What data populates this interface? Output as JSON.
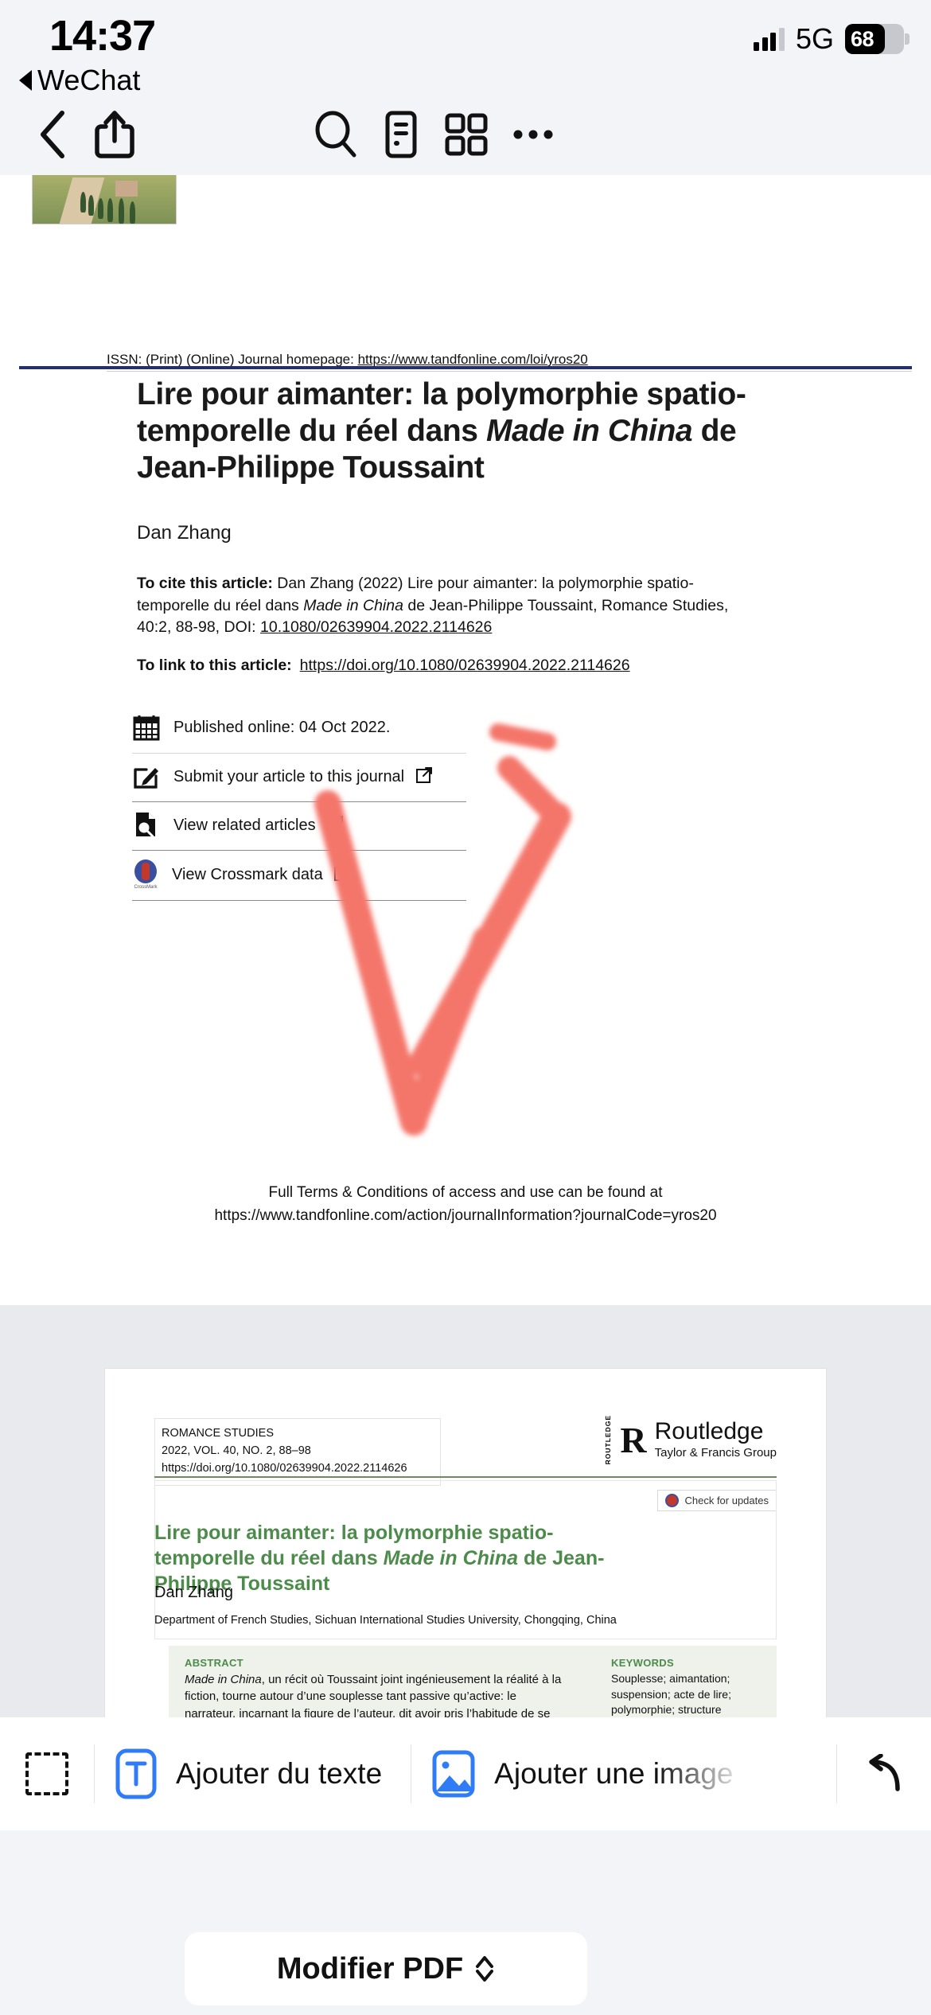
{
  "status_bar": {
    "time": "14:37",
    "back_app": "WeChat",
    "network": "5G",
    "battery": "68"
  },
  "toolbar": {
    "back": "back-chevron",
    "share": "share",
    "search": "search",
    "outline": "outline",
    "thumbnails": "thumbnails",
    "more": "more"
  },
  "document": {
    "page1": {
      "issn_line": "ISSN: (Print) (Online) Journal homepage: ",
      "issn_url": "https://www.tandfonline.com/loi/yros20",
      "title_part1": "Lire pour aimanter: la polymorphie spatio-temporelle du réel dans ",
      "title_italic": "Made in China",
      "title_part2": " de Jean-Philippe Toussaint",
      "author": "Dan Zhang",
      "cite_label": "To cite this article:",
      "cite_text_a": " Dan Zhang (2022) Lire pour aimanter: la polymorphie spatio-temporelle du réel dans ",
      "cite_italic": "Made in China",
      "cite_text_b": " de Jean-Philippe Toussaint, Romance Studies, 40:2, 88-98, DOI: ",
      "cite_doi": "10.1080/02639904.2022.2114626",
      "link_label": "To link to this article:",
      "link_url": "https://doi.org/10.1080/02639904.2022.2114626",
      "published": "Published online: 04 Oct 2022.",
      "submit": "Submit your article to this journal",
      "related": "View related articles",
      "crossmark": "View Crossmark data",
      "crossmark_caption": "CrossMark",
      "footer_line1": "Full Terms & Conditions of access and use can be found at",
      "footer_line2": "https://www.tandfonline.com/action/journalInformation?journalCode=yros20"
    },
    "page2": {
      "journal": "ROMANCE STUDIES",
      "issue": "2022, VOL. 40, NO. 2, 88–98",
      "doi": "https://doi.org/10.1080/02639904.2022.2114626",
      "publisher_name": "Routledge",
      "publisher_sub": "Taylor & Francis Group",
      "publisher_mark": "R",
      "publisher_vertical": "ROUTLEDGE",
      "check_updates": "Check for updates",
      "title_part1": "Lire pour aimanter: la polymorphie spatio-temporelle du réel dans ",
      "title_italic": "Made in China",
      "title_part2": " de Jean-Philippe Toussaint",
      "author": "Dan Zhang",
      "affiliation": "Department of French Studies, Sichuan International Studies University, Chongqing, China",
      "abstract_heading": "ABSTRACT",
      "abstract_italic": "Made in China",
      "abstract_text": ", un récit où Toussaint joint ingénieusement la réalité à la fiction, tourne autour d’une souplesse tant passive qu’active: le narrateur, incarnant la figure de l’auteur, dit avoir pris l’habitude de se laisser porter par les événements, mais s’apprête aussi à accueillir le hasard et à ‘aimanter du vivant’. Notre analyse s’articule autour de l’énergie magnétique constitutive du processus d’aimantation et basée dans Made in China sur une narration non-linéaire. À la",
      "keywords_heading": "KEYWORDS",
      "keywords_text": "Souplesse; aimantation; suspension; acte de lire; polymorphie; structure d’horizon"
    }
  },
  "annotation": {
    "color": "#F4766B",
    "shape": "hand-drawn-check-mark"
  },
  "edit_bar": {
    "select_icon": "dashed-selection",
    "add_text": "Ajouter du texte",
    "add_image": "Ajouter une image",
    "undo_icon": "undo"
  },
  "bottom": {
    "modify_pdf": "Modifier PDF"
  },
  "colors": {
    "accent_blue": "#2F7CF6",
    "journal_green": "#4C8B4A",
    "annotation_red": "#F4766B",
    "rule_navy": "#23306B"
  }
}
